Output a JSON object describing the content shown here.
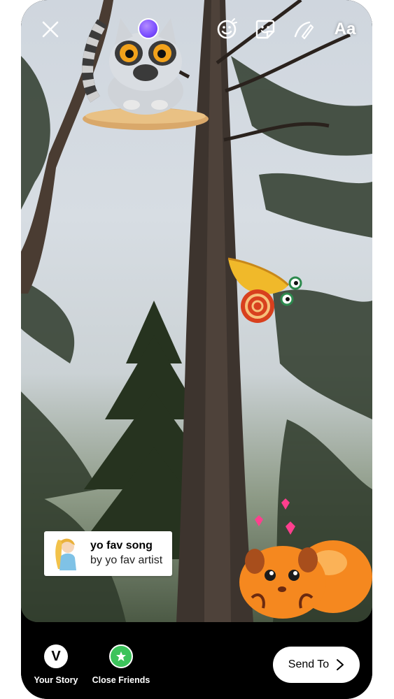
{
  "topbar": {
    "close_icon": "close-icon",
    "text_tool_label": "Aa",
    "icons": [
      "effects-icon",
      "sticker-icon",
      "draw-icon"
    ]
  },
  "music_sticker": {
    "song": "yo fav song",
    "artist": "by yo fav artist"
  },
  "share": {
    "your_story": {
      "initial": "V",
      "label": "Your Story"
    },
    "close_friends": {
      "icon": "star-icon",
      "label": "Close Friends",
      "color": "#3cc35b"
    },
    "send_to_label": "Send To"
  }
}
